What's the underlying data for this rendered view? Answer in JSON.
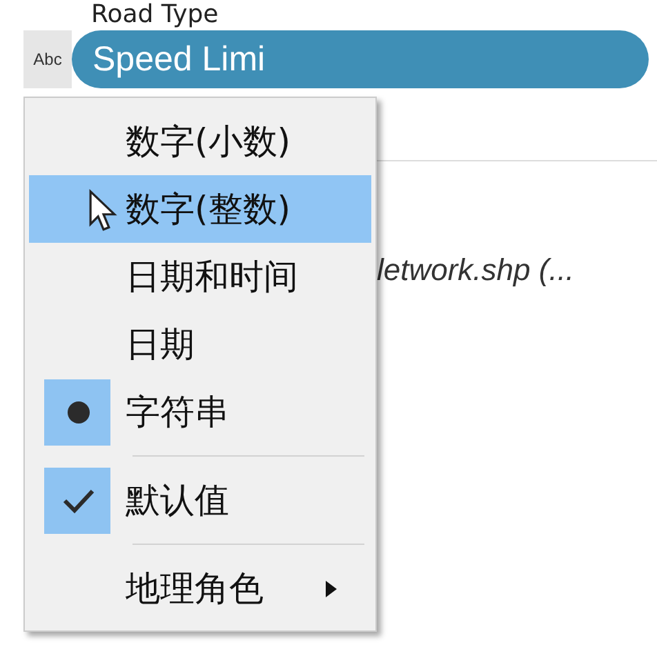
{
  "field_heading": "Road Type",
  "field": {
    "type_icon": "Abc",
    "name": "Speed Limi",
    "selected": true
  },
  "source_text": "letwork.shp (...",
  "menu": {
    "groups": [
      [
        {
          "label": "数字(小数)",
          "kind": "radio",
          "selected": false,
          "highlighted": false
        },
        {
          "label": "数字(整数)",
          "kind": "radio",
          "selected": false,
          "highlighted": true
        },
        {
          "label": "日期和时间",
          "kind": "radio",
          "selected": false,
          "highlighted": false
        },
        {
          "label": "日期",
          "kind": "radio",
          "selected": false,
          "highlighted": false
        },
        {
          "label": "字符串",
          "kind": "radio",
          "selected": true,
          "highlighted": false
        }
      ],
      [
        {
          "label": "默认值",
          "kind": "check",
          "checked": true,
          "highlighted": false
        }
      ],
      [
        {
          "label": "地理角色",
          "kind": "submenu",
          "highlighted": false
        }
      ]
    ]
  }
}
